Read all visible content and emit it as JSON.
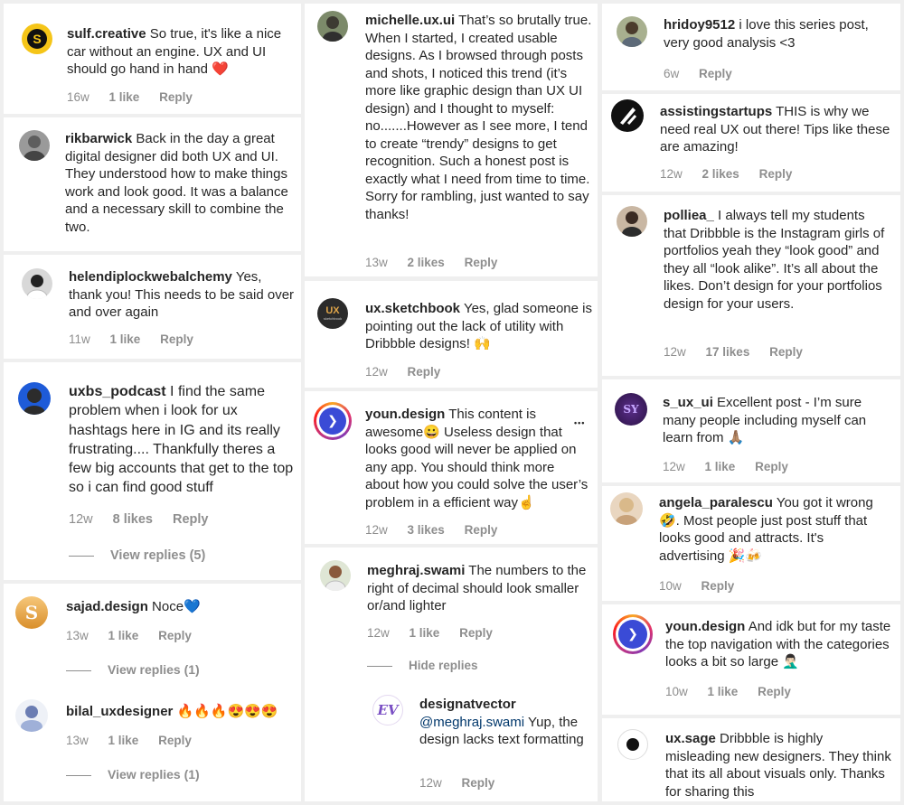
{
  "col1": [
    {
      "user": "sulf.creative",
      "text": "So true, it's like a nice car without an engine. UX and UI should go hand in hand ❤️",
      "time": "16w",
      "likes": "1 like",
      "reply": "Reply"
    },
    {
      "user": "rikbarwick",
      "text": "Back in the day a great digital designer did both UX and UI. They understood how to make things work and look good. It was a balance and a necessary skill to combine the two."
    },
    {
      "user": "helendiplockwebalchemy",
      "text": "Yes, thank you! This needs to be said over and over again",
      "time": "11w",
      "likes": "1 like",
      "reply": "Reply"
    },
    {
      "user": "uxbs_podcast",
      "text": "I find the same problem when i look for ux hashtags here in IG and its really frustrating.... Thankfully theres a few big accounts that get to the top so i can find good stuff",
      "time": "12w",
      "likes": "8 likes",
      "reply": "Reply",
      "view_replies": "View replies (5)"
    },
    {
      "user": "sajad.design",
      "text": "Noce💙",
      "time": "13w",
      "likes": "1 like",
      "reply": "Reply",
      "view_replies": "View replies (1)"
    },
    {
      "user": "bilal_uxdesigner",
      "text": "🔥🔥🔥😍😍😍",
      "time": "13w",
      "likes": "1 like",
      "reply": "Reply",
      "view_replies": "View replies (1)"
    }
  ],
  "col2": [
    {
      "user": "michelle.ux.ui",
      "text": "That’s so brutally true. When I started, I created usable designs. As I browsed through posts and shots, I noticed this trend (it’s more like graphic design than UX UI design) and I thought to myself: no.......However as I see more, I tend to create “trendy” designs to get recognition. Such a honest post is exactly what I need from time to time. Sorry for rambling, just wanted to say thanks!",
      "time": "13w",
      "likes": "2 likes",
      "reply": "Reply"
    },
    {
      "user": "ux.sketchbook",
      "avatar_text": "UX",
      "avatar_sub": "sketchbook",
      "text": "Yes, glad someone is pointing out the lack of utility with Dribbble designs! 🙌",
      "time": "12w",
      "reply": "Reply"
    },
    {
      "user": "youn.design",
      "text": "This content is awesome😀 Useless design that looks good will never be applied on any app. You should think more about how you could solve the user’s problem in a efficient way☝️",
      "time": "12w",
      "likes": "3 likes",
      "reply": "Reply",
      "more": "•••"
    },
    {
      "user": "meghraj.swami",
      "text": "The numbers to the right of decimal should look smaller or/and lighter",
      "time": "12w",
      "likes": "1 like",
      "reply": "Reply",
      "hide_replies": "Hide replies",
      "child": {
        "user": "designatvector",
        "mention": "@meghraj.swami",
        "text": "Yup, the design lacks text formatting",
        "time": "12w",
        "reply": "Reply"
      }
    }
  ],
  "col3": [
    {
      "user": "hridoy9512",
      "text": "i love this series post, very good analysis <3",
      "time": "6w",
      "reply": "Reply"
    },
    {
      "user": "assistingstartups",
      "text": "THIS is why we need real UX out there! Tips like these are amazing!",
      "time": "12w",
      "likes": "2 likes",
      "reply": "Reply"
    },
    {
      "user": "polliea_",
      "text": "I always tell my students that Dribbble is the Instagram girls of portfolios yeah they “look good” and they all “look alike”. It’s all about the likes. Don’t design for your portfolios design for your users.",
      "time": "12w",
      "likes": "17 likes",
      "reply": "Reply"
    },
    {
      "user": "s_ux_ui",
      "avatar_text": "SY",
      "text": "Excellent post - I’m sure many people including myself can learn from 🙏🏽",
      "time": "12w",
      "likes": "1 like",
      "reply": "Reply"
    },
    {
      "user": "angela_paralescu",
      "text": "You got it wrong 🤣. Most people just post stuff that looks good and attracts. It's advertising 🎉🍻",
      "time": "10w",
      "reply": "Reply"
    },
    {
      "user": "youn.design",
      "text": "And idk but for my taste the top navigation with the categories looks a bit so large 🤦🏻‍♂️",
      "time": "10w",
      "likes": "1 like",
      "reply": "Reply"
    },
    {
      "user": "ux.sage",
      "text": "Dribbble is highly misleading new designers. They think that its all about visuals only. Thanks for sharing this"
    }
  ],
  "colors": {
    "bg": "#efefef",
    "card": "#ffffff",
    "text": "#262626",
    "muted": "#8e8e8e",
    "mention": "#00376b",
    "accent_blue": "#3a4bd6"
  }
}
